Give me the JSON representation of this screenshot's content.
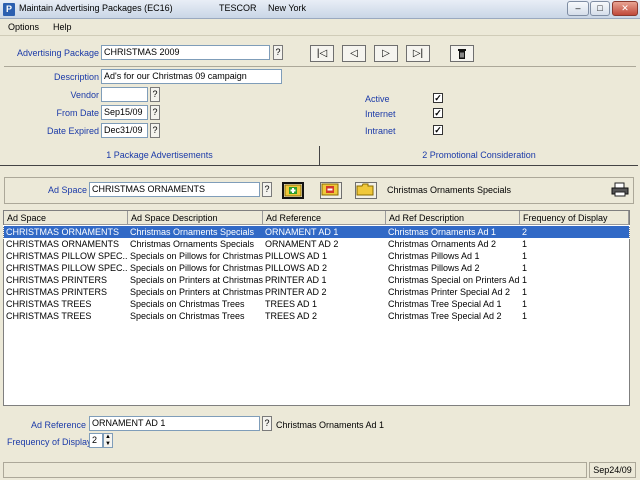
{
  "window": {
    "title": "Maintain Advertising Packages (EC16)",
    "company": "TESCOR",
    "location": "New York"
  },
  "menu": [
    "Options",
    "Help"
  ],
  "header": {
    "advertising_package_label": "Advertising Package",
    "advertising_package_value": "CHRISTMAS 2009",
    "description_label": "Description",
    "description_value": "Ad's for our Christmas 09 campaign",
    "vendor_label": "Vendor",
    "vendor_value": "",
    "from_date_label": "From Date",
    "from_date_value": "Sep15/09",
    "date_expired_label": "Date Expired",
    "date_expired_value": "Dec31/09",
    "active_label": "Active",
    "active_checked": true,
    "internet_label": "Internet",
    "internet_checked": true,
    "intranet_label": "Intranet",
    "intranet_checked": true,
    "lookup_label": "?"
  },
  "tabs": [
    {
      "label": "1 Package Advertisements",
      "active": true
    },
    {
      "label": "2 Promotional Consideration",
      "active": false
    }
  ],
  "ad_space": {
    "label": "Ad Space",
    "value": "CHRISTMAS ORNAMENTS",
    "description": "Christmas Ornaments Specials"
  },
  "grid": {
    "columns": [
      "Ad Space",
      "Ad Space Description",
      "Ad Reference",
      "Ad Ref Description",
      "Frequency of Display"
    ],
    "rows": [
      [
        "CHRISTMAS ORNAMENTS",
        "Christmas Ornaments Specials",
        "ORNAMENT AD 1",
        "Christmas Ornaments Ad 1",
        "2"
      ],
      [
        "CHRISTMAS ORNAMENTS",
        "Christmas Ornaments Specials",
        "ORNAMENT AD 2",
        "Christmas Ornaments Ad 2",
        "1"
      ],
      [
        "CHRISTMAS PILLOW SPEC...",
        "Specials on Pillows for Christmas",
        "PILLOWS AD 1",
        "Christmas Pillows Ad 1",
        "1"
      ],
      [
        "CHRISTMAS PILLOW SPEC...",
        "Specials on Pillows for Christmas",
        "PILLOWS AD 2",
        "Christmas Pillows Ad 2",
        "1"
      ],
      [
        "CHRISTMAS PRINTERS",
        "Specials on Printers at Christmas",
        "PRINTER AD 1",
        "Christmas Special on Printers Ad 1",
        "1"
      ],
      [
        "CHRISTMAS PRINTERS",
        "Specials on Printers at Christmas",
        "PRINTER AD 2",
        "Christmas Printer Special Ad 2",
        "1"
      ],
      [
        "CHRISTMAS TREES",
        "Specials on Christmas Trees",
        "TREES AD 1",
        "Christmas Tree Special Ad 1",
        "1"
      ],
      [
        "CHRISTMAS TREES",
        "Specials on Christmas Trees",
        "TREES AD 2",
        "Christmas Tree Special Ad 2",
        "1"
      ]
    ],
    "selected_row": 0
  },
  "detail": {
    "ad_reference_label": "Ad Reference",
    "ad_reference_value": "ORNAMENT AD 1",
    "ad_reference_description": "Christmas Ornaments Ad 1",
    "frequency_label": "Frequency of Display",
    "frequency_value": "2"
  },
  "status": {
    "message": "",
    "date": "Sep24/09"
  },
  "colors": {
    "label_blue": "#1b3aa8",
    "selection": "#3169c6",
    "add_icon": "#2e9e2e",
    "remove_icon": "#d43a2a",
    "folder": "#f0c83a"
  },
  "icons": [
    "app-icon",
    "first-record-icon",
    "previous-record-icon",
    "next-record-icon",
    "last-record-icon",
    "delete-icon",
    "add-icon",
    "remove-icon",
    "folder-icon",
    "printer-icon"
  ]
}
